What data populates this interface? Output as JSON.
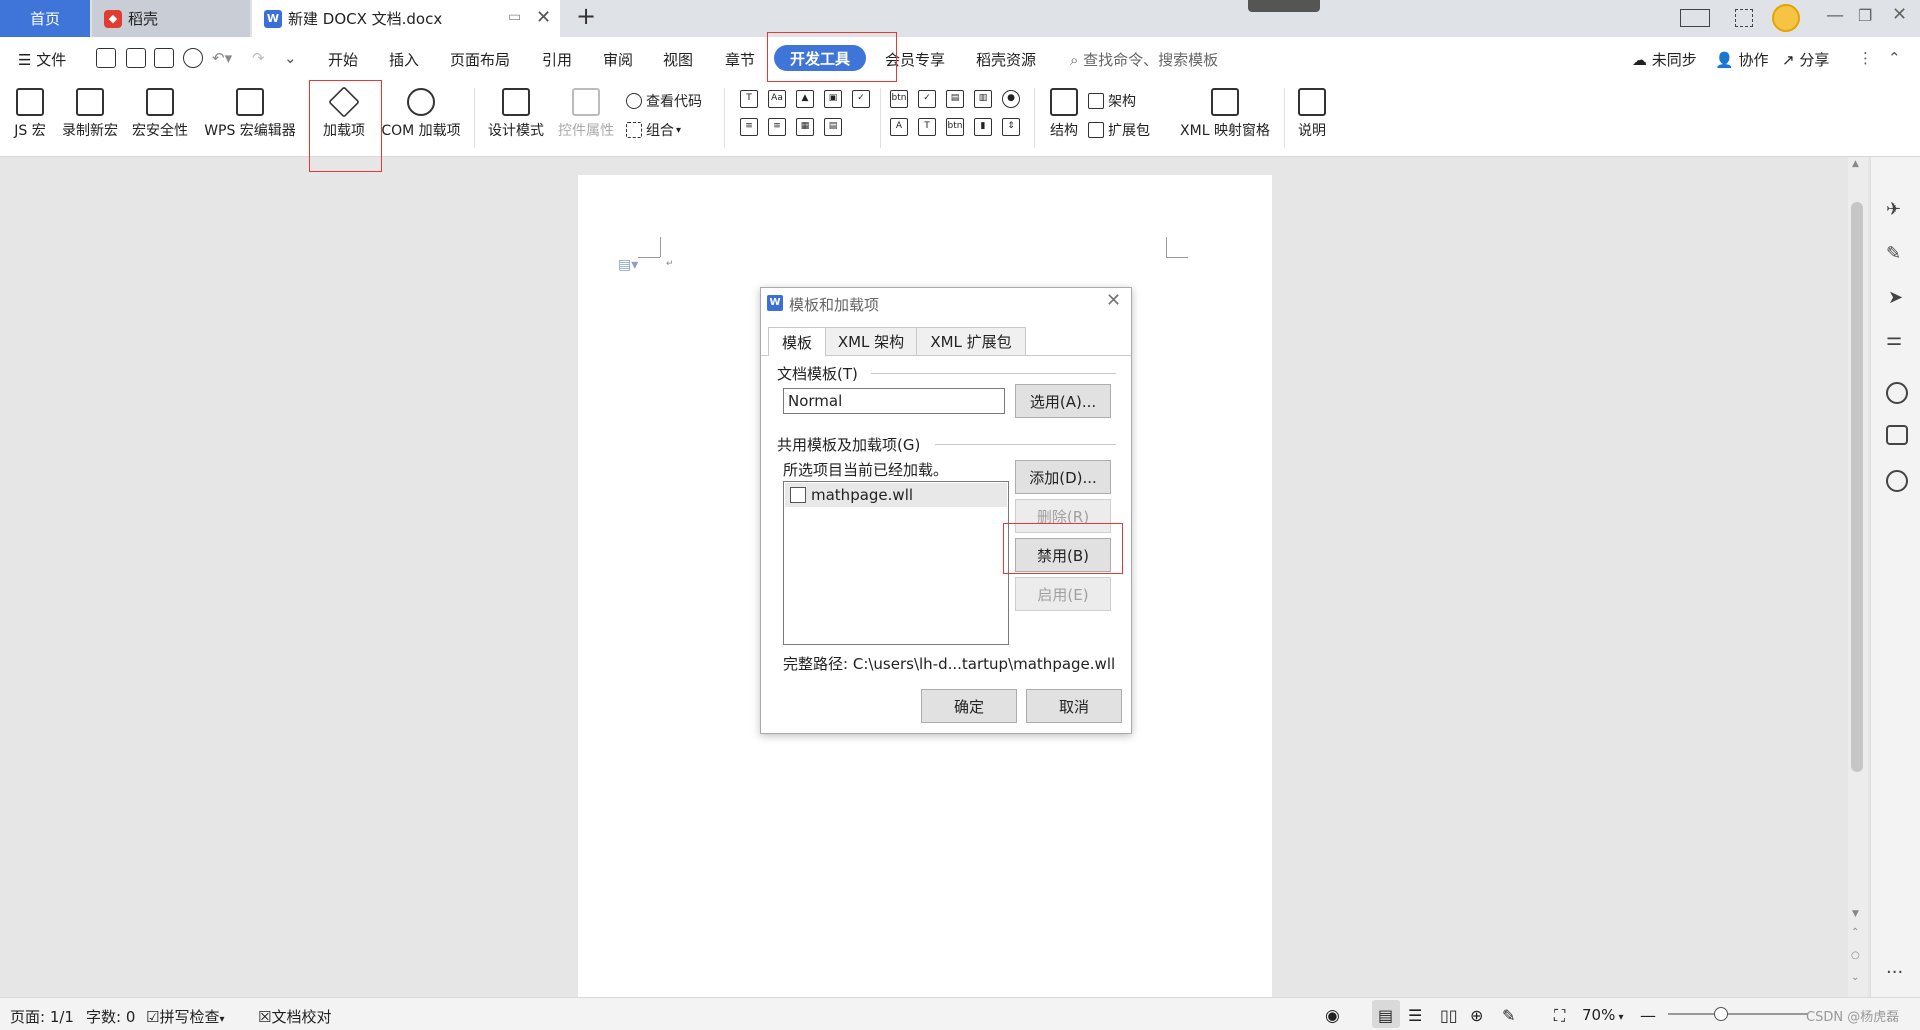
{
  "tabs": {
    "home": "首页",
    "daoke": "稻壳",
    "doc": "新建 DOCX 文档.docx",
    "new_tab": "+"
  },
  "menu": {
    "file": "文件",
    "items": [
      "开始",
      "插入",
      "页面布局",
      "引用",
      "审阅",
      "视图",
      "章节",
      "开发工具",
      "会员专享",
      "稻壳资源"
    ],
    "active": "开发工具",
    "search_placeholder": "查找命令、搜索模板",
    "sync": "未同步",
    "collab": "协作",
    "share": "分享"
  },
  "toolbar": {
    "js_macro": "JS 宏",
    "record_macro": "录制新宏",
    "macro_security": "宏安全性",
    "wps_macro_editor": "WPS 宏编辑器",
    "addins": "加载项",
    "com_addins": "COM 加载项",
    "design_mode": "设计模式",
    "control_props": "控件属性",
    "view_code": "查看代码",
    "group": "组合",
    "structure_group": "架构",
    "structure": "结构",
    "expansion_pack": "扩展包",
    "xml_mapping": "XML 映射窗格",
    "help": "说明"
  },
  "dialog": {
    "title": "模板和加载项",
    "tabs": [
      "模板",
      "XML 架构",
      "XML 扩展包"
    ],
    "doc_template_label": "文档模板(T)",
    "doc_template_value": "Normal",
    "select_button": "选用(A)...",
    "global_label": "共用模板及加载项(G)",
    "loaded_note": "所选项目当前已经加载。",
    "items": [
      {
        "name": "mathpage.wll",
        "checked": false
      }
    ],
    "add_button": "添加(D)...",
    "delete_button": "删除(R)",
    "disable_button": "禁用(B)",
    "enable_button": "启用(E)",
    "full_path_label": "完整路径:",
    "full_path_value": "C:\\users\\lh-d...tartup\\mathpage.wll",
    "ok_button": "确定",
    "cancel_button": "取消"
  },
  "status": {
    "page": "页面: 1/1",
    "words": "字数: 0",
    "spell_check": "拼写检查",
    "doc_check": "文档校对",
    "zoom": "70%",
    "watermark": "CSDN @杨虎磊"
  },
  "colors": {
    "accent": "#3f75d8",
    "highlight_box": "#e53935"
  }
}
